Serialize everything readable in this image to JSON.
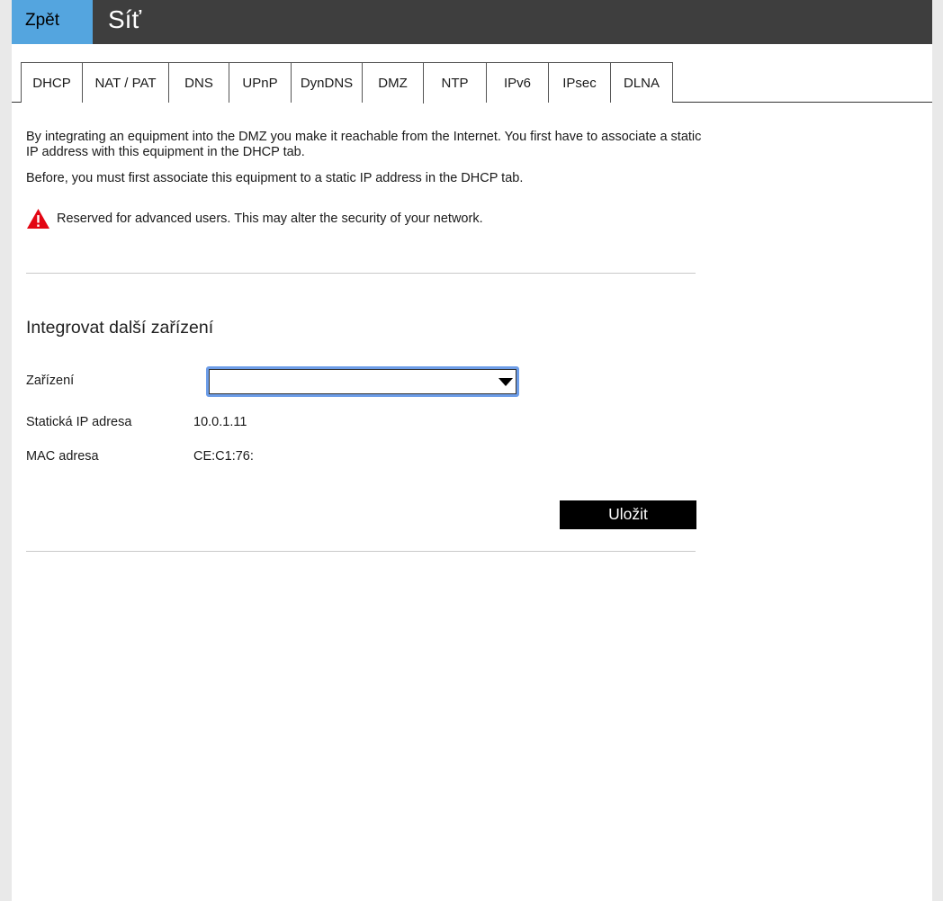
{
  "header": {
    "back_label": "Zpět",
    "title": "Síť"
  },
  "tabs": [
    {
      "label": "DHCP"
    },
    {
      "label": "NAT / PAT"
    },
    {
      "label": "DNS"
    },
    {
      "label": "UPnP"
    },
    {
      "label": "DynDNS"
    },
    {
      "label": "DMZ",
      "active": true
    },
    {
      "label": "NTP"
    },
    {
      "label": "IPv6"
    },
    {
      "label": "IPsec"
    },
    {
      "label": "DLNA"
    }
  ],
  "intro": {
    "line1": "By integrating an equipment into the DMZ you make it reachable from the Internet. You first have to associate a static IP address with this equipment in the DHCP tab.",
    "line2": "Before, you must first associate this equipment to a static IP address in the DHCP tab.",
    "warning": "Reserved for advanced users. This may alter the security of your network."
  },
  "form": {
    "section_title": "Integrovat další zařízení",
    "device_label": "Zařízení",
    "device_value": "",
    "ip_label": "Statická IP adresa",
    "ip_value": "10.0.1.11",
    "mac_label": "MAC adresa",
    "mac_value": "CE:C1:76:",
    "save_label": "Uložit"
  },
  "colors": {
    "accent": "#54a5df",
    "header_bg": "#3e3e3e",
    "warning": "#e30613",
    "focus_ring": "#6d9de8"
  }
}
